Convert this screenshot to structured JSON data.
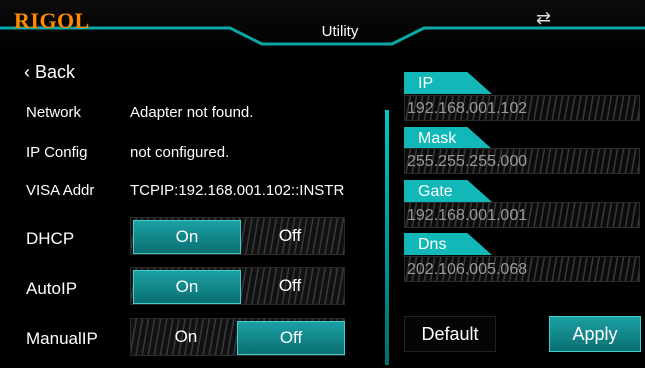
{
  "header": {
    "logo": "RIGOL",
    "title": "Utility",
    "usb_icon": "usb-connection-icon"
  },
  "back": {
    "label": "Back",
    "icon": "chevron-left-icon"
  },
  "info_rows": [
    {
      "label": "Network",
      "value": "Adapter not found."
    },
    {
      "label": "IP Config",
      "value": "not configured."
    },
    {
      "label": "VISA Addr",
      "value": "TCPIP:192.168.001.102::INSTR"
    }
  ],
  "toggles": [
    {
      "label": "DHCP",
      "on": "On",
      "off": "Off",
      "selected": "On"
    },
    {
      "label": "AutoIP",
      "on": "On",
      "off": "Off",
      "selected": "On"
    },
    {
      "label": "ManualIP",
      "on": "On",
      "off": "Off",
      "selected": "Off"
    }
  ],
  "network_fields": [
    {
      "label": "IP",
      "value": "192.168.001.102"
    },
    {
      "label": "Mask",
      "value": "255.255.255.000"
    },
    {
      "label": "Gate",
      "value": "192.168.001.001"
    },
    {
      "label": "Dns",
      "value": "202.106.005.068"
    }
  ],
  "buttons": {
    "default": "Default",
    "apply": "Apply"
  },
  "colors": {
    "accent": "#12b7b7",
    "logo": "#ff8a00",
    "background": "#000000"
  }
}
